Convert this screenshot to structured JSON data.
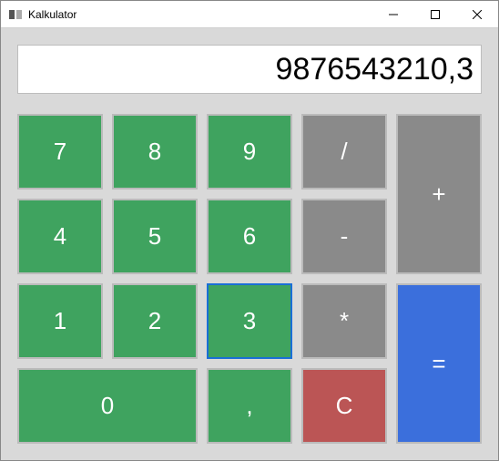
{
  "window": {
    "title": "Kalkulator"
  },
  "display": {
    "value": "9876543210,3"
  },
  "buttons": {
    "seven": "7",
    "eight": "8",
    "nine": "9",
    "divide": "/",
    "plus": "+",
    "four": "4",
    "five": "5",
    "six": "6",
    "minus": "-",
    "one": "1",
    "two": "2",
    "three": "3",
    "multiply": "*",
    "equals": "=",
    "zero": "0",
    "comma": ",",
    "clear": "C"
  },
  "focused_key": "three"
}
